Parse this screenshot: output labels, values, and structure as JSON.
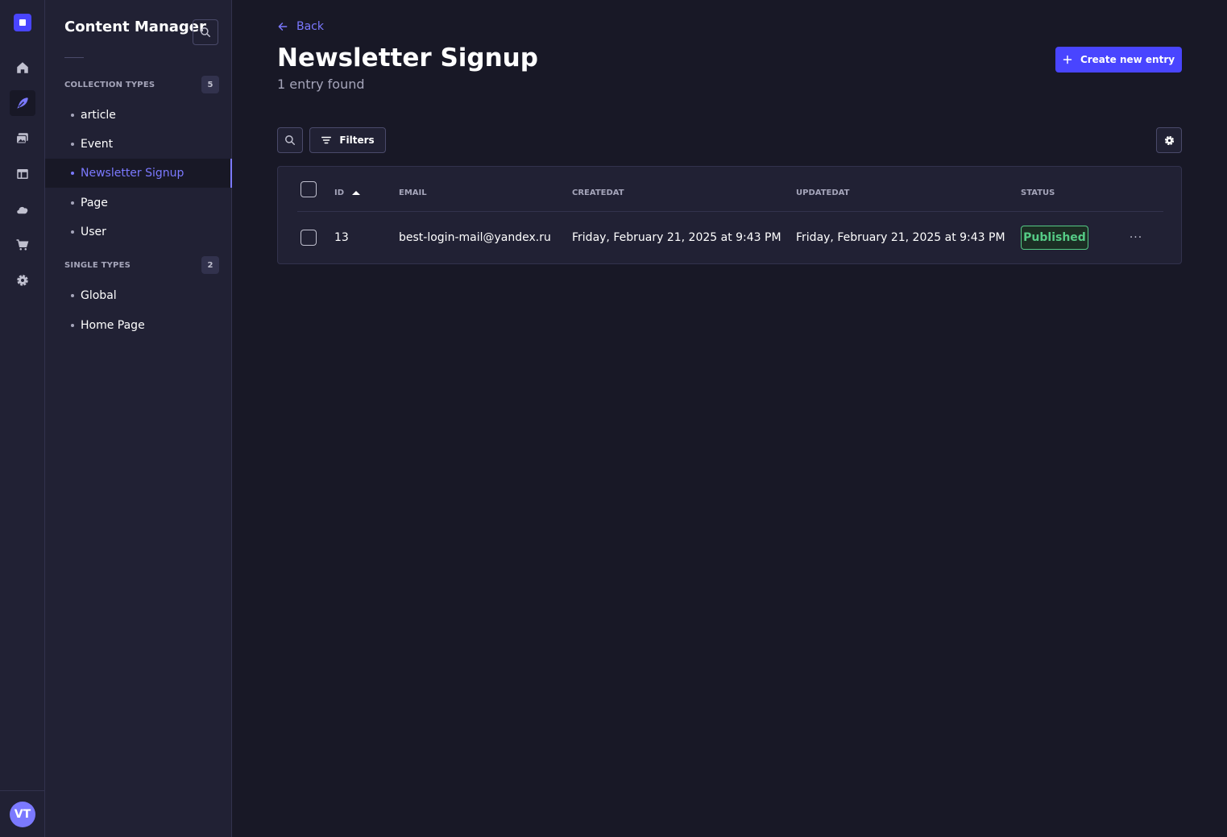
{
  "rail": {
    "items": [
      {
        "name": "home-icon",
        "active": false
      },
      {
        "name": "content-manager-icon",
        "active": true
      },
      {
        "name": "media-library-icon",
        "active": false
      },
      {
        "name": "content-type-builder-icon",
        "active": false
      },
      {
        "name": "cloud-icon",
        "active": false
      },
      {
        "name": "marketplace-icon",
        "active": false
      },
      {
        "name": "settings-icon",
        "active": false
      }
    ],
    "avatar_initials": "VT"
  },
  "subnav": {
    "title": "Content Manager",
    "collection_types": {
      "title": "COLLECTION TYPES",
      "count": "5",
      "items": [
        "article",
        "Event",
        "Newsletter Signup",
        "Page",
        "User"
      ],
      "active": "Newsletter Signup"
    },
    "single_types": {
      "title": "SINGLE TYPES",
      "count": "2",
      "items": [
        "Global",
        "Home Page"
      ]
    }
  },
  "header": {
    "back_label": "Back",
    "title": "Newsletter Signup",
    "subtitle": "1 entry found",
    "create_label": "Create new entry"
  },
  "toolbar": {
    "filters_label": "Filters"
  },
  "table": {
    "columns": [
      "ID",
      "EMAIL",
      "CREATEDAT",
      "UPDATEDAT",
      "STATUS"
    ],
    "sort_column": "ID",
    "sort_direction": "asc",
    "rows": [
      {
        "id": "13",
        "email": "best-login-mail@yandex.ru",
        "createdAt": "Friday, February 21, 2025 at 9:43 PM",
        "updatedAt": "Friday, February 21, 2025 at 9:43 PM",
        "status": "Published",
        "menu": "···"
      }
    ]
  },
  "colors": {
    "primary": "#4945ff",
    "accent": "#7b79ff",
    "success": "#55cb85",
    "background": "#181826",
    "panel": "#212134"
  }
}
